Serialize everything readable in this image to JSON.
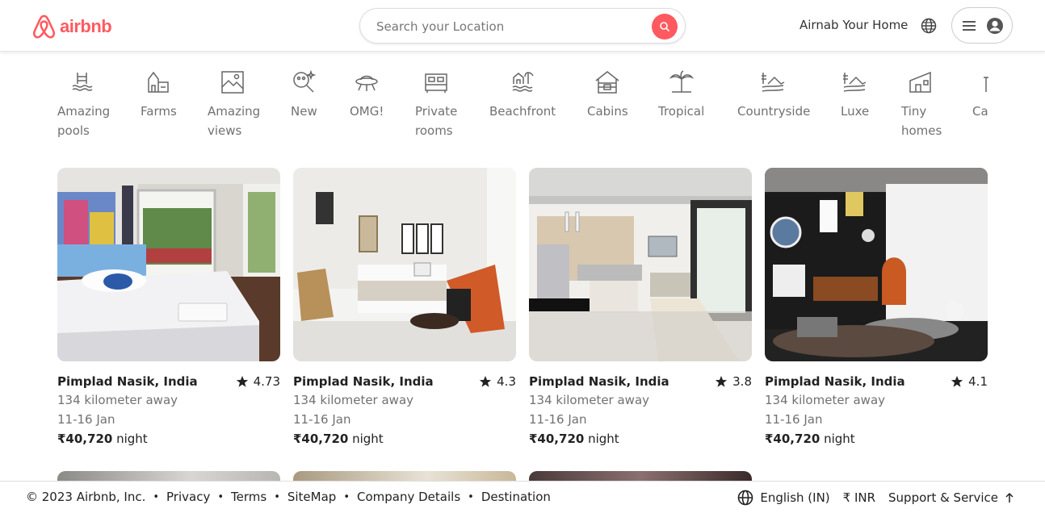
{
  "brand": {
    "name": "airbnb",
    "color": "#FF5A5F"
  },
  "search": {
    "placeholder": "Search your Location"
  },
  "header": {
    "host_link": "Airnab Your Home"
  },
  "categories": [
    {
      "label": "Amazing pools",
      "icon": "pool-icon"
    },
    {
      "label": "Farms",
      "icon": "farm-icon"
    },
    {
      "label": "Amazing views",
      "icon": "view-icon"
    },
    {
      "label": "New",
      "icon": "new-icon"
    },
    {
      "label": "OMG!",
      "icon": "ufo-icon"
    },
    {
      "label": "Private rooms",
      "icon": "bed-icon"
    },
    {
      "label": "Beachfront",
      "icon": "beach-icon"
    },
    {
      "label": "Cabins",
      "icon": "cabin-icon"
    },
    {
      "label": "Tropical",
      "icon": "palm-icon"
    },
    {
      "label": "Countryside",
      "icon": "countryside-icon"
    },
    {
      "label": "Luxe",
      "icon": "luxe-icon"
    },
    {
      "label": "Tiny homes",
      "icon": "tiny-home-icon"
    },
    {
      "label": "Ca",
      "icon": "castle-icon"
    }
  ],
  "listings": [
    {
      "location": "Pimplad Nasik, India",
      "rating": "4.73",
      "distance": "134 kilometer away",
      "dates": "11-16 Jan",
      "price": "₹40,720",
      "unit": "night"
    },
    {
      "location": "Pimplad Nasik, India",
      "rating": "4.3",
      "distance": "134 kilometer away",
      "dates": "11-16 Jan",
      "price": "₹40,720",
      "unit": "night"
    },
    {
      "location": "Pimplad Nasik, India",
      "rating": "3.8",
      "distance": "134 kilometer away",
      "dates": "11-16 Jan",
      "price": "₹40,720",
      "unit": "night"
    },
    {
      "location": "Pimplad Nasik, India",
      "rating": "4.1",
      "distance": "134 kilometer away",
      "dates": "11-16 Jan",
      "price": "₹40,720",
      "unit": "night"
    }
  ],
  "footer": {
    "copyright": "© 2023 Airbnb, Inc.",
    "links": [
      "Privacy",
      "Terms",
      "SiteMap",
      "Company Details",
      "Destination"
    ],
    "language": "English (IN)",
    "currency": "₹ INR",
    "support": "Support & Service"
  }
}
